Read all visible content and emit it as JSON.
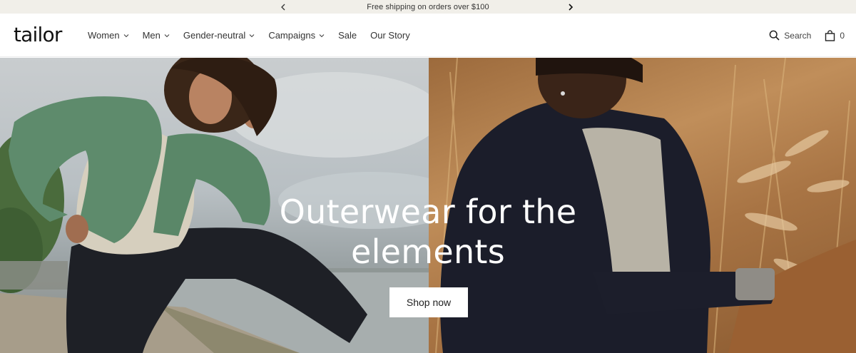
{
  "announcement": {
    "text": "Free shipping on orders over $100"
  },
  "header": {
    "logo": "tailor",
    "nav": [
      {
        "label": "Women",
        "has_dropdown": true
      },
      {
        "label": "Men",
        "has_dropdown": true
      },
      {
        "label": "Gender-neutral",
        "has_dropdown": true
      },
      {
        "label": "Campaigns",
        "has_dropdown": true
      },
      {
        "label": "Sale",
        "has_dropdown": false
      },
      {
        "label": "Our Story",
        "has_dropdown": false
      }
    ],
    "search_label": "Search",
    "cart_count": "0"
  },
  "hero": {
    "heading_line1": "Outerwear for the",
    "heading_line2": "elements",
    "cta_label": "Shop now"
  },
  "colors": {
    "announcement_bg": "#f1efe9",
    "button_bg": "#ffffff",
    "heading_text": "#ffffff"
  }
}
